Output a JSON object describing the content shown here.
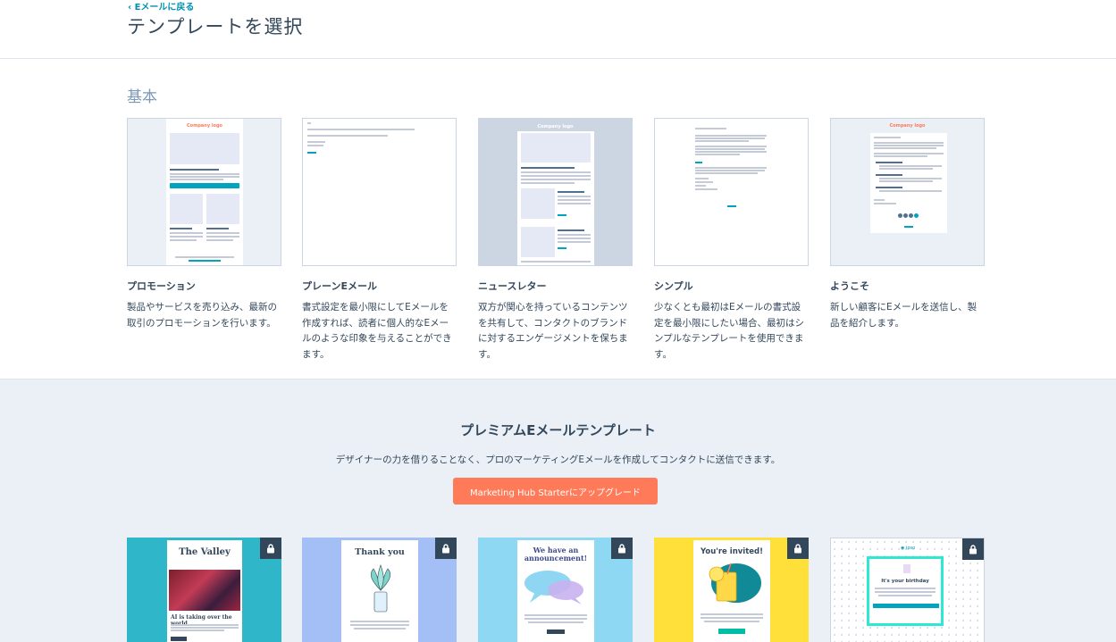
{
  "header": {
    "back_label": "‹ Eメールに戻る",
    "title": "テンプレートを選択"
  },
  "basic_section": {
    "title": "基本",
    "templates": [
      {
        "name": "プロモーション",
        "description": "製品やサービスを売り込み、最新の取引のプロモーションを行います。",
        "thumb_logo": "Company logo",
        "thumb_heading": "Promote your goods and services",
        "thumb_sub1": "Highlight your best deals",
        "thumb_sub2": "Highlight your best deals"
      },
      {
        "name": "プレーンEメール",
        "description": "書式設定を最小限にしてEメールを作成すれば、読者に個人的なEメールのような印象を与えることができます。"
      },
      {
        "name": "ニュースレター",
        "description": "双方が関心を持っているコンテンツを共有して、コンタクトのブランドに対するエンゲージメントを保ちます。",
        "thumb_heading": "Share your latest news and updates",
        "thumb_sub1": "Spread the word",
        "thumb_sub2": "Spread the word"
      },
      {
        "name": "シンプル",
        "description": "少なくとも最初はEメールの書式設定を最小限にしたい場合、最初はシンプルなテンプレートを使用できます。"
      },
      {
        "name": "ようこそ",
        "description": "新しい顧客にEメールを送信し、製品を紹介します。",
        "thumb_logo": "Company logo"
      }
    ]
  },
  "premium_section": {
    "title": "プレミアムEメールテンプレート",
    "subtitle": "デザイナーの力を借りることなく、プロのマーケティングEメールを作成してコンタクトに送信できます。",
    "upgrade_label": "Marketing Hub Starterにアップグレード",
    "templates": [
      {
        "title": "The Valley",
        "caption": "AI is taking over the world",
        "bg": "#2fb7c9"
      },
      {
        "title": "Thank you",
        "bg": "#a4bff5"
      },
      {
        "title": "We have an announcement!",
        "bg": "#8fd8f4"
      },
      {
        "title": "You're invited!",
        "bg": "#ffe03b"
      },
      {
        "title": "It's your birthday",
        "bg": "#ffffff"
      }
    ]
  },
  "icons": {
    "lock": "lock-icon"
  },
  "colors": {
    "accent": "#ff7a59",
    "teal": "#00a4bd",
    "text": "#33475b",
    "link": "#0091ae"
  }
}
